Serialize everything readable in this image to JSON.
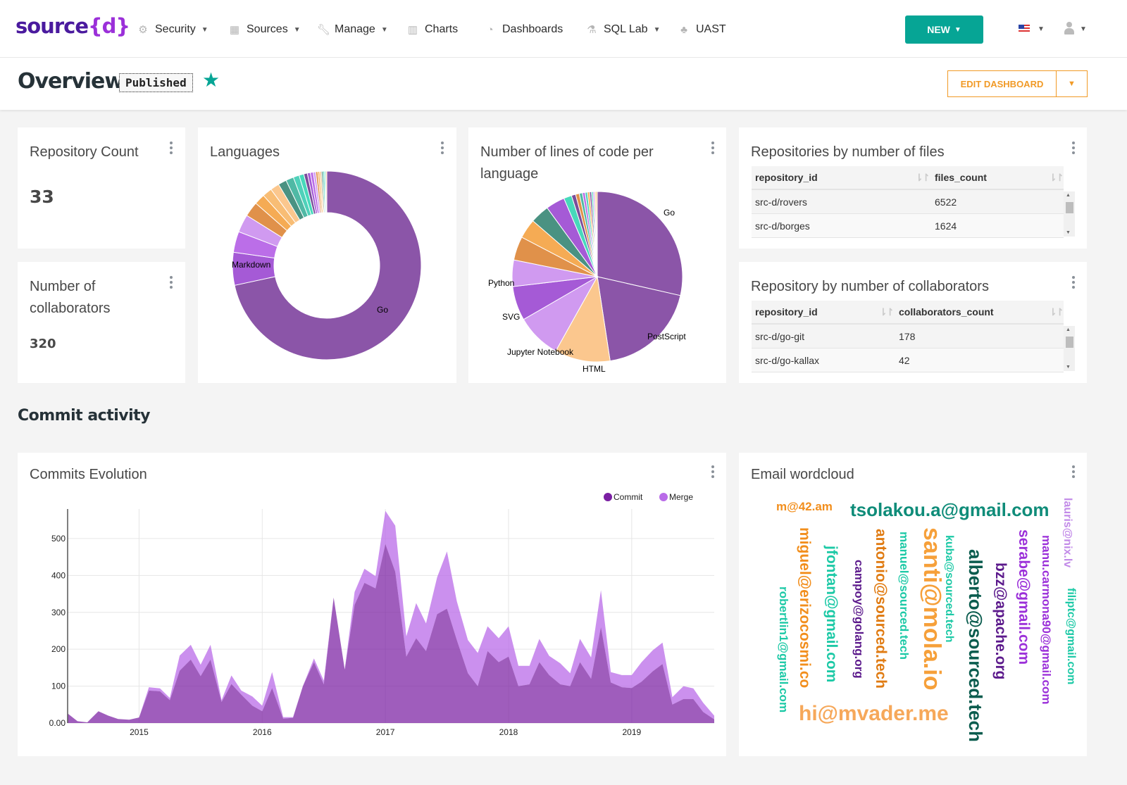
{
  "navbar": {
    "logo_main": "source",
    "logo_brace_open": "{",
    "logo_brace_letter": "d",
    "logo_brace_close": "}",
    "items": [
      {
        "label": "Security",
        "icon": "gears-icon",
        "has_caret": true
      },
      {
        "label": "Sources",
        "icon": "table-icon",
        "has_caret": true
      },
      {
        "label": "Manage",
        "icon": "wrench-icon",
        "has_caret": true
      },
      {
        "label": "Charts",
        "icon": "bar-chart-icon",
        "has_caret": false
      },
      {
        "label": "Dashboards",
        "icon": "dashboard-icon",
        "has_caret": false
      },
      {
        "label": "SQL Lab",
        "icon": "flask-icon",
        "has_caret": true
      },
      {
        "label": "UAST",
        "icon": "tree-icon",
        "has_caret": false
      }
    ],
    "new_button": "NEW",
    "language_flag": "us-flag",
    "user_menu": "user-icon"
  },
  "header": {
    "title": "Overview",
    "status_badge": "Published",
    "favorite": true,
    "edit_button": "EDIT DASHBOARD"
  },
  "kpis": {
    "repo_count": {
      "title": "Repository Count",
      "value": "33"
    },
    "collaborators": {
      "title": "Number of collaborators",
      "title_line1": "Number of",
      "title_line2": "collaborators",
      "value": "320"
    }
  },
  "section_title": "Commit activity",
  "tables": {
    "files": {
      "title": "Repositories by number of files",
      "columns": [
        "repository_id",
        "files_count"
      ],
      "rows": [
        [
          "src-d/rovers",
          "6522"
        ],
        [
          "src-d/borges",
          "1624"
        ]
      ]
    },
    "collaborators": {
      "title": "Repository by number of collaborators",
      "columns": [
        "repository_id",
        "collaborators_count"
      ],
      "rows": [
        [
          "src-d/go-git",
          "178"
        ],
        [
          "src-d/go-kallax",
          "42"
        ]
      ]
    }
  },
  "colors": {
    "accent": "#06a595",
    "edit": "#f19a26",
    "commit": "#7a1fa2",
    "merge": "#b96be8"
  },
  "chart_data": [
    {
      "id": "languages",
      "type": "pie",
      "variant": "donut",
      "title": "Languages",
      "labels_shown": [
        "Go",
        "Markdown"
      ],
      "slices": [
        {
          "label": "Go",
          "value": 70.0,
          "color": "#8b55a8"
        },
        {
          "label": "Markdown",
          "value": 5.5,
          "color": "#a55ad6"
        },
        {
          "label": "",
          "value": 3.5,
          "color": "#bb6ee8"
        },
        {
          "label": "",
          "value": 3.0,
          "color": "#d09af0"
        },
        {
          "label": "",
          "value": 2.5,
          "color": "#e0914a"
        },
        {
          "label": "",
          "value": 1.8,
          "color": "#f5ab54"
        },
        {
          "label": "",
          "value": 1.6,
          "color": "#f8bd75"
        },
        {
          "label": "",
          "value": 1.5,
          "color": "#fbc78e"
        },
        {
          "label": "",
          "value": 1.4,
          "color": "#4a9282"
        },
        {
          "label": "",
          "value": 1.3,
          "color": "#4fb9a5"
        },
        {
          "label": "",
          "value": 1.0,
          "color": "#4fd1ba"
        },
        {
          "label": "",
          "value": 0.8,
          "color": "#47d9bb"
        },
        {
          "label": "",
          "value": 0.6,
          "color": "#7a4d9a"
        },
        {
          "label": "",
          "value": 0.5,
          "color": "#a55ad6"
        },
        {
          "label": "",
          "value": 0.5,
          "color": "#bb6ee8"
        },
        {
          "label": "",
          "value": 0.4,
          "color": "#d09af0"
        },
        {
          "label": "",
          "value": 0.35,
          "color": "#e0914a"
        },
        {
          "label": "",
          "value": 0.3,
          "color": "#f5ab54"
        },
        {
          "label": "",
          "value": 0.3,
          "color": "#fbc78e"
        },
        {
          "label": "",
          "value": 0.25,
          "color": "#4a9282"
        },
        {
          "label": "",
          "value": 0.25,
          "color": "#4fd1ba"
        },
        {
          "label": "",
          "value": 0.2,
          "color": "#47d9bb"
        },
        {
          "label": "",
          "value": 0.2,
          "color": "#fbc78e"
        }
      ]
    },
    {
      "id": "loc",
      "type": "pie",
      "title": "Number of lines of code per language",
      "title_line1": "Number of lines of code per",
      "title_line2": "language",
      "labels_shown": [
        "Go",
        "PostScript",
        "HTML",
        "Jupyter Notebook",
        "SVG",
        "Python"
      ],
      "slices": [
        {
          "label": "Go",
          "value": 28.5,
          "color": "#8b55a8"
        },
        {
          "label": "PostScript",
          "value": 19.0,
          "color": "#8b55a8"
        },
        {
          "label": "HTML",
          "value": 10.5,
          "color": "#fbc78e"
        },
        {
          "label": "Jupyter Notebook",
          "value": 8.5,
          "color": "#d09af0"
        },
        {
          "label": "SVG",
          "value": 6.5,
          "color": "#a55ad6"
        },
        {
          "label": "Python",
          "value": 5.0,
          "color": "#d09af0"
        },
        {
          "label": "",
          "value": 4.5,
          "color": "#e0914a"
        },
        {
          "label": "",
          "value": 3.7,
          "color": "#f5ab54"
        },
        {
          "label": "",
          "value": 3.6,
          "color": "#4a9282"
        },
        {
          "label": "",
          "value": 3.6,
          "color": "#a55ad6"
        },
        {
          "label": "",
          "value": 1.5,
          "color": "#47d9bb"
        },
        {
          "label": "",
          "value": 0.8,
          "color": "#7a4d9a"
        },
        {
          "label": "",
          "value": 0.7,
          "color": "#e0914a"
        },
        {
          "label": "",
          "value": 0.6,
          "color": "#4fb9a5"
        },
        {
          "label": "",
          "value": 0.5,
          "color": "#bb6ee8"
        },
        {
          "label": "",
          "value": 0.45,
          "color": "#4fd1ba"
        },
        {
          "label": "",
          "value": 0.4,
          "color": "#f5ab54"
        },
        {
          "label": "",
          "value": 0.35,
          "color": "#7a4d9a"
        },
        {
          "label": "",
          "value": 0.3,
          "color": "#47d9bb"
        },
        {
          "label": "",
          "value": 0.3,
          "color": "#d09af0"
        },
        {
          "label": "",
          "value": 0.25,
          "color": "#fbc78e"
        },
        {
          "label": "",
          "value": 0.25,
          "color": "#f5ab54"
        }
      ]
    },
    {
      "id": "commits",
      "type": "area",
      "stacked": true,
      "title": "Commits Evolution",
      "xlabel": "",
      "ylabel": "",
      "legend": "top-right",
      "grid": true,
      "ylim": [
        0,
        580
      ],
      "xlim": [
        2014.42,
        2019.67
      ],
      "yticks": [
        0,
        100,
        200,
        300,
        400,
        500
      ],
      "ytick_labels": [
        "0.00",
        "100",
        "200",
        "300",
        "400",
        "500"
      ],
      "xticks": [
        2015,
        2016,
        2017,
        2018,
        2019
      ],
      "xtick_labels": [
        "2015",
        "2016",
        "2017",
        "2018",
        "2019"
      ],
      "x": [
        2014.42,
        2014.5,
        2014.58,
        2014.67,
        2014.75,
        2014.83,
        2014.92,
        2015.0,
        2015.08,
        2015.17,
        2015.25,
        2015.33,
        2015.42,
        2015.5,
        2015.58,
        2015.67,
        2015.75,
        2015.83,
        2015.92,
        2016.0,
        2016.08,
        2016.17,
        2016.25,
        2016.33,
        2016.42,
        2016.5,
        2016.58,
        2016.67,
        2016.75,
        2016.83,
        2016.92,
        2017.0,
        2017.08,
        2017.17,
        2017.25,
        2017.33,
        2017.42,
        2017.5,
        2017.58,
        2017.67,
        2017.75,
        2017.83,
        2017.92,
        2018.0,
        2018.08,
        2018.17,
        2018.25,
        2018.33,
        2018.42,
        2018.5,
        2018.58,
        2018.67,
        2018.75,
        2018.83,
        2018.92,
        2019.0,
        2019.08,
        2019.17,
        2019.25,
        2019.33,
        2019.42,
        2019.5,
        2019.58,
        2019.67
      ],
      "series": [
        {
          "name": "Commit",
          "color": "#7a1fa2",
          "values": [
            26,
            5,
            2,
            32,
            20,
            11,
            9,
            15,
            88,
            86,
            62,
            142,
            172,
            127,
            172,
            57,
            106,
            77,
            47,
            32,
            95,
            12,
            14,
            100,
            165,
            105,
            340,
            145,
            320,
            380,
            365,
            485,
            410,
            180,
            230,
            195,
            295,
            310,
            225,
            135,
            100,
            195,
            165,
            180,
            100,
            105,
            165,
            130,
            105,
            100,
            165,
            120,
            260,
            110,
            97,
            95,
            112,
            140,
            160,
            50,
            65,
            65,
            30,
            10
          ]
        },
        {
          "name": "Merge",
          "color": "#b96be8",
          "values": [
            0,
            0,
            0,
            0,
            0,
            0,
            0,
            0,
            9,
            8,
            6,
            41,
            40,
            31,
            40,
            5,
            23,
            11,
            25,
            15,
            43,
            4,
            2,
            0,
            10,
            10,
            0,
            0,
            35,
            38,
            33,
            90,
            125,
            55,
            95,
            75,
            100,
            155,
            105,
            90,
            90,
            67,
            65,
            82,
            55,
            50,
            63,
            52,
            57,
            35,
            63,
            58,
            100,
            28,
            33,
            35,
            53,
            57,
            58,
            20,
            35,
            29,
            25,
            10
          ]
        }
      ]
    }
  ],
  "wordcloud": {
    "title": "Email wordcloud",
    "words": [
      {
        "text": "m@42.am",
        "color": "#f28e1c",
        "size": 17,
        "rotate": 0
      },
      {
        "text": "tsolakou.a@gmail.com",
        "color": "#0f8c79",
        "size": 26,
        "rotate": 0
      },
      {
        "text": "lauris@nix.lv",
        "color": "#c28ae8",
        "size": 16,
        "rotate": 90
      },
      {
        "text": "miguel@erizocosmi.co",
        "color": "#f28e1c",
        "size": 21,
        "rotate": 90
      },
      {
        "text": "robertlin1@gmail.com",
        "color": "#1cc9a6",
        "size": 17,
        "rotate": 90
      },
      {
        "text": "jfontan@gmail.com",
        "color": "#1cc9a6",
        "size": 21,
        "rotate": 90
      },
      {
        "text": "campoy@golang.org",
        "color": "#5c1a8c",
        "size": 17,
        "rotate": 90
      },
      {
        "text": "antonio@sourced.tech",
        "color": "#e07b12",
        "size": 21,
        "rotate": 90
      },
      {
        "text": "manuel@sourced.tech",
        "color": "#1cc9a6",
        "size": 17,
        "rotate": 90
      },
      {
        "text": "santi@mola.io",
        "color": "#f6a03a",
        "size": 34,
        "rotate": 90
      },
      {
        "text": "kuba@sourced.tech",
        "color": "#1cc9a6",
        "size": 16,
        "rotate": 90
      },
      {
        "text": "alberto@sourced.tech",
        "color": "#0a5c4e",
        "size": 26,
        "rotate": 90
      },
      {
        "text": "bzz@apache.org",
        "color": "#5c1a8c",
        "size": 21,
        "rotate": 90
      },
      {
        "text": "serabe@gmail.com",
        "color": "#9b30d9",
        "size": 21,
        "rotate": 90
      },
      {
        "text": "manu.carmona90@gmail.com",
        "color": "#9b30d9",
        "size": 17,
        "rotate": 90
      },
      {
        "text": "filiptc@gmail.com",
        "color": "#1cc9a6",
        "size": 16,
        "rotate": 90
      },
      {
        "text": "hi@mvader.me",
        "color": "#f6a85a",
        "size": 30,
        "rotate": 0
      }
    ]
  }
}
